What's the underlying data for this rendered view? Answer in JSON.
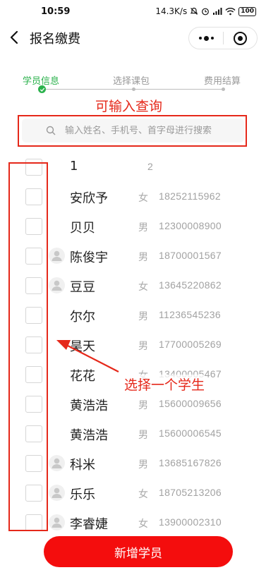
{
  "status_bar": {
    "time": "10:59",
    "net_speed": "14.3K/s",
    "battery": "100"
  },
  "nav": {
    "title": "报名缴费"
  },
  "steps": [
    {
      "label": "学员信息",
      "state": "active"
    },
    {
      "label": "选择课包",
      "state": "pending"
    },
    {
      "label": "费用结算",
      "state": "pending"
    }
  ],
  "annotations": {
    "search_note": "可输入查询",
    "select_note": "选择一个学生"
  },
  "search": {
    "placeholder": "输入姓名、手机号、首字母进行搜索",
    "value": ""
  },
  "students": [
    {
      "name": "1",
      "gender": "",
      "phone": "2",
      "has_avatar": false
    },
    {
      "name": "安欣予",
      "gender": "女",
      "phone": "18252115962",
      "has_avatar": false
    },
    {
      "name": "贝贝",
      "gender": "男",
      "phone": "12300008900",
      "has_avatar": false
    },
    {
      "name": "陈俊宇",
      "gender": "男",
      "phone": "18700001567",
      "has_avatar": true
    },
    {
      "name": "豆豆",
      "gender": "女",
      "phone": "13645220862",
      "has_avatar": true
    },
    {
      "name": "尔尔",
      "gender": "男",
      "phone": "11236545236",
      "has_avatar": false
    },
    {
      "name": "昊天",
      "gender": "男",
      "phone": "17700005269",
      "has_avatar": false
    },
    {
      "name": "花花",
      "gender": "女",
      "phone": "13400005467",
      "has_avatar": false
    },
    {
      "name": "黄浩浩",
      "gender": "男",
      "phone": "15600009656",
      "has_avatar": false
    },
    {
      "name": "黄浩浩",
      "gender": "男",
      "phone": "15600006545",
      "has_avatar": false
    },
    {
      "name": "科米",
      "gender": "男",
      "phone": "13685167826",
      "has_avatar": true
    },
    {
      "name": "乐乐",
      "gender": "女",
      "phone": "18705213206",
      "has_avatar": true
    },
    {
      "name": "李睿婕",
      "gender": "女",
      "phone": "13900002310",
      "has_avatar": true
    }
  ],
  "footer": {
    "add_button_label": "新增学员"
  },
  "colors": {
    "active_green": "#2bb24c",
    "annotation_red": "#e5281a",
    "button_red": "#f40d0d"
  }
}
